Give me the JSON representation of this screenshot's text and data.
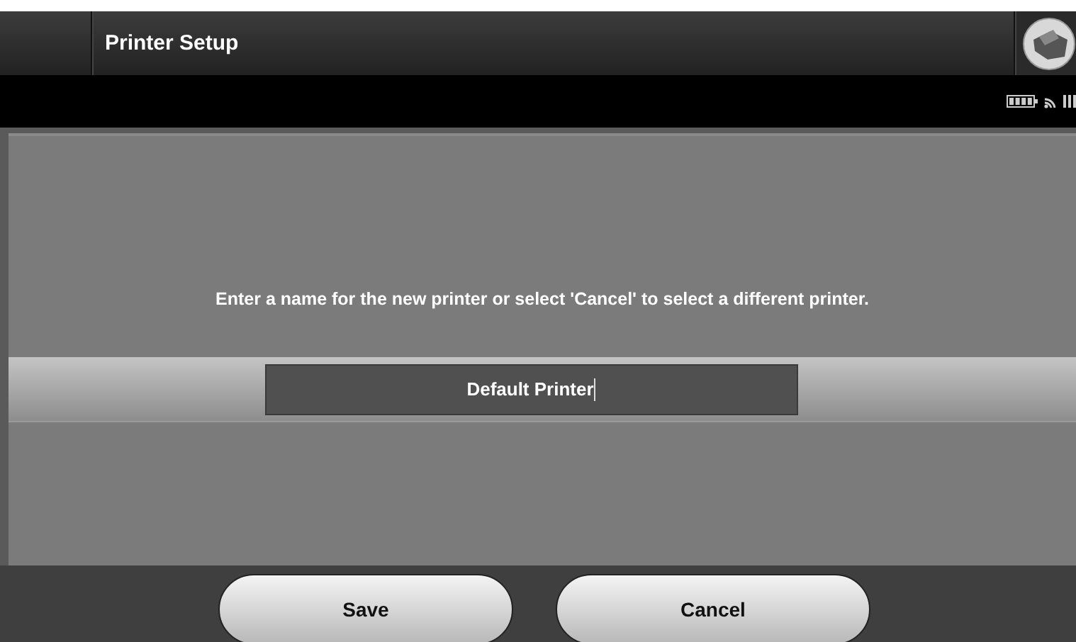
{
  "header": {
    "title": "Printer Setup"
  },
  "message": "Enter a name for the new printer or select 'Cancel' to select a different printer.",
  "name_field": {
    "value": "Default Printer"
  },
  "buttons": [
    {
      "label": "Save"
    },
    {
      "label": "Cancel"
    }
  ]
}
